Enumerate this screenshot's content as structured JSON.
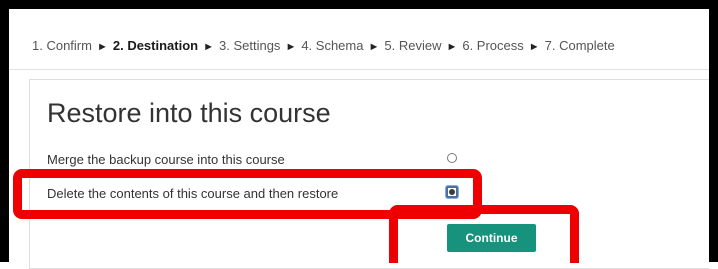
{
  "breadcrumb": {
    "steps": [
      {
        "label": "1. Confirm",
        "current": false
      },
      {
        "label": "2. Destination",
        "current": true
      },
      {
        "label": "3. Settings",
        "current": false
      },
      {
        "label": "4. Schema",
        "current": false
      },
      {
        "label": "5. Review",
        "current": false
      },
      {
        "label": "6. Process",
        "current": false
      },
      {
        "label": "7. Complete",
        "current": false
      }
    ],
    "separator": "►"
  },
  "panel": {
    "title": "Restore into this course",
    "options": [
      {
        "label": "Merge the backup course into this course",
        "selected": false
      },
      {
        "label": "Delete the contents of this course and then restore",
        "selected": true
      }
    ],
    "continue_label": "Continue"
  },
  "colors": {
    "button": "#17927d",
    "highlight": "#ee0000",
    "frame": "#000000"
  }
}
